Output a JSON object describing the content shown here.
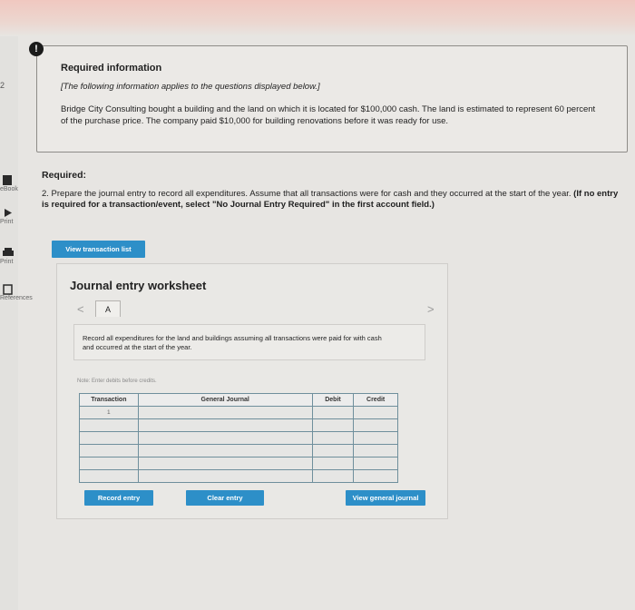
{
  "sidebar": {
    "number": "2",
    "items": [
      {
        "label": "eBook",
        "icon": "book-icon"
      },
      {
        "label": "Print",
        "icon": "print-icon"
      },
      {
        "label": "Print",
        "icon": "printer-icon"
      },
      {
        "label": "References",
        "icon": "references-icon"
      }
    ]
  },
  "info": {
    "badge": "!",
    "title": "Required information",
    "subtitle": "[The following information applies to the questions displayed below.]",
    "body": "Bridge City Consulting bought a building and the land on which it is located for $100,000 cash. The land is estimated to represent 60 percent of the purchase price. The company paid $10,000 for building renovations before it was ready for use."
  },
  "requirement": {
    "heading": "Required:",
    "text": "2. Prepare the journal entry to record all expenditures. Assume that all transactions were for cash and they occurred at the start of the year.",
    "bold_note": "(If no entry is required for a transaction/event, select \"No Journal Entry Required\" in the first account field.)"
  },
  "buttons": {
    "view_transaction_list": "View transaction list",
    "record_entry": "Record entry",
    "clear_entry": "Clear entry",
    "view_general_journal": "View general journal"
  },
  "worksheet": {
    "title": "Journal entry worksheet",
    "prev": "<",
    "next": ">",
    "tab": "A",
    "description": "Record all expenditures for the land and buildings assuming all transactions were paid for with cash and occurred at the start of the year.",
    "note": "Note: Enter debits before credits.",
    "columns": [
      "Transaction",
      "General Journal",
      "Debit",
      "Credit"
    ],
    "transaction_number": "1"
  },
  "colors": {
    "button": "#2d8fc8",
    "table_border": "#6f8f9c"
  }
}
